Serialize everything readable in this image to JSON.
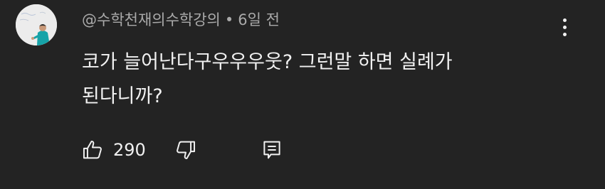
{
  "comment": {
    "author": "@수학천재의수학강의",
    "separator": "•",
    "time": "6일 전",
    "text_lines": [
      "코가 늘어난다구우우우웃? 그런말 하면 실례가",
      "된다니까?"
    ],
    "likes": "290"
  },
  "icons": {
    "avatar": "avatar-image",
    "more": "more-vertical-icon",
    "like": "thumbs-up-icon",
    "dislike": "thumbs-down-icon",
    "reply": "reply-comment-icon"
  },
  "colors": {
    "background": "#232323",
    "primary_text": "#f1f1f1",
    "secondary_text": "#aaaaaa"
  }
}
